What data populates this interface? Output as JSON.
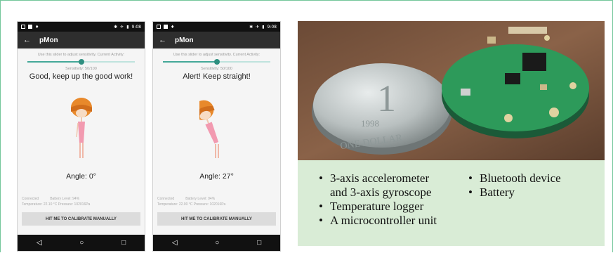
{
  "phones": [
    {
      "status_time": "9:08",
      "title": "pMon",
      "hint": "Use this slider to adjust sensitivity.  Current Activity:",
      "sensitivity": "Sensitivity: 50/100",
      "slider_value": 0.5,
      "message": "Good, keep up the good work!",
      "angle": "Angle: 0°",
      "status_connected": "Connected",
      "battery": "Battery Level: 94%",
      "temp_pressure": "Temperature: 22.10 °C Pressure: 102016Pa",
      "calibrate_label": "HIT ME TO CALIBRATE MANUALLY",
      "nav_back": "◁",
      "nav_home": "○",
      "nav_recent": "□"
    },
    {
      "status_time": "9:08",
      "title": "pMon",
      "hint": "Use this slider to adjust sensitivity.  Current Activity:",
      "sensitivity": "Sensitivity: 50/100",
      "slider_value": 0.5,
      "message": "Alert! Keep straight!",
      "angle": "Angle: 27°",
      "status_connected": "Connected",
      "battery": "Battery Level: 94%",
      "temp_pressure": "Temperature: 22.00 °C Pressure: 102016Pa",
      "calibrate_label": "HIT ME TO CALIBRATE MANUALLY",
      "nav_back": "◁",
      "nav_home": "○",
      "nav_recent": "□"
    }
  ],
  "photo": {
    "coin_numeral": "1",
    "coin_year": "1998",
    "coin_text": "ONE DOLLAR"
  },
  "features": {
    "col1": [
      "3-axis accelerometer",
      "and 3-axis gyroscope",
      "Temperature logger",
      "A microcontroller unit"
    ],
    "col2": [
      "Bluetooth device",
      "Battery"
    ]
  },
  "colors": {
    "frame": "#74c69b",
    "accent": "#44a898",
    "caption_bg": "#d9ecd6"
  }
}
